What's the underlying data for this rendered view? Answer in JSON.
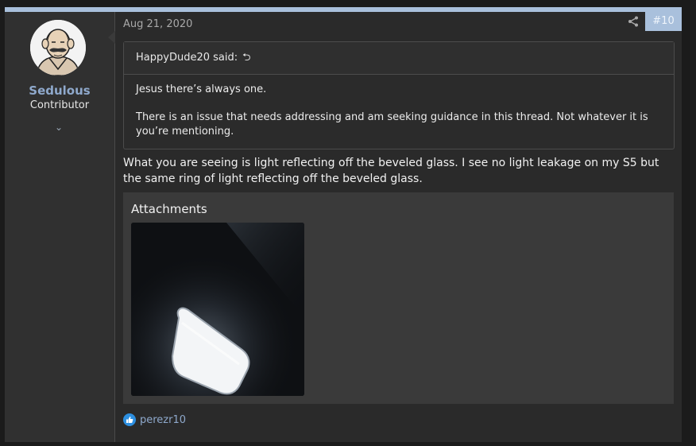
{
  "post": {
    "date": "Aug 21, 2020",
    "number": "#10",
    "share_icon": "share-icon"
  },
  "user": {
    "name": "Sedulous",
    "title": "Contributor",
    "expand_glyph": "⌄"
  },
  "quote": {
    "author_line": "HappyDude20 said:",
    "back_glyph": "⮌",
    "paragraphs": [
      "Jesus there’s always one.",
      "There is an issue that needs addressing and am seeking guidance in this thread. Not whatever it is you’re mentioning."
    ]
  },
  "message": "What you are seeing is light reflecting off the beveled glass. I see no light leakage on my S5 but the same ring of light reflecting off the beveled glass.",
  "attachments": {
    "title": "Attachments"
  },
  "reactions": {
    "icon": "like-icon",
    "users": "perezr10"
  },
  "colors": {
    "accent": "#a9c0dc",
    "username": "#8fa9cc",
    "like": "#2d8fe0"
  }
}
